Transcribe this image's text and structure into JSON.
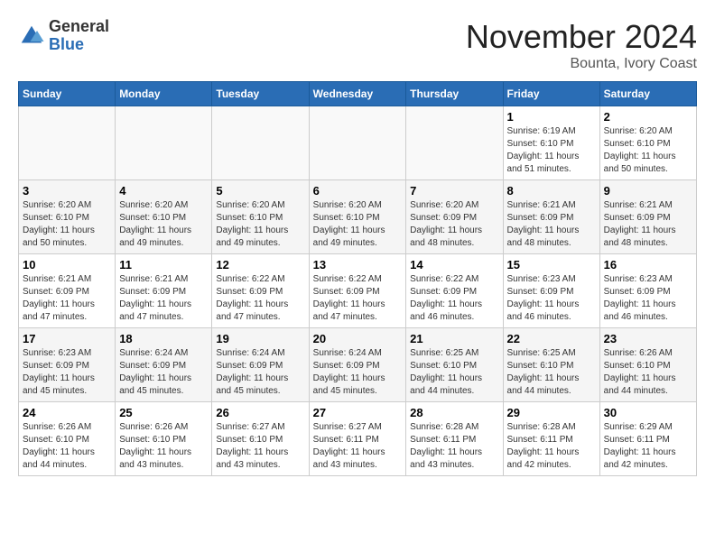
{
  "header": {
    "logo_general": "General",
    "logo_blue": "Blue",
    "month_title": "November 2024",
    "location": "Bounta, Ivory Coast"
  },
  "days_of_week": [
    "Sunday",
    "Monday",
    "Tuesday",
    "Wednesday",
    "Thursday",
    "Friday",
    "Saturday"
  ],
  "weeks": [
    {
      "days": [
        {
          "num": "",
          "empty": true
        },
        {
          "num": "",
          "empty": true
        },
        {
          "num": "",
          "empty": true
        },
        {
          "num": "",
          "empty": true
        },
        {
          "num": "",
          "empty": true
        },
        {
          "num": "1",
          "sunrise": "6:19 AM",
          "sunset": "6:10 PM",
          "daylight": "11 hours and 51 minutes."
        },
        {
          "num": "2",
          "sunrise": "6:20 AM",
          "sunset": "6:10 PM",
          "daylight": "11 hours and 50 minutes."
        }
      ]
    },
    {
      "days": [
        {
          "num": "3",
          "sunrise": "6:20 AM",
          "sunset": "6:10 PM",
          "daylight": "11 hours and 50 minutes."
        },
        {
          "num": "4",
          "sunrise": "6:20 AM",
          "sunset": "6:10 PM",
          "daylight": "11 hours and 49 minutes."
        },
        {
          "num": "5",
          "sunrise": "6:20 AM",
          "sunset": "6:10 PM",
          "daylight": "11 hours and 49 minutes."
        },
        {
          "num": "6",
          "sunrise": "6:20 AM",
          "sunset": "6:10 PM",
          "daylight": "11 hours and 49 minutes."
        },
        {
          "num": "7",
          "sunrise": "6:20 AM",
          "sunset": "6:09 PM",
          "daylight": "11 hours and 48 minutes."
        },
        {
          "num": "8",
          "sunrise": "6:21 AM",
          "sunset": "6:09 PM",
          "daylight": "11 hours and 48 minutes."
        },
        {
          "num": "9",
          "sunrise": "6:21 AM",
          "sunset": "6:09 PM",
          "daylight": "11 hours and 48 minutes."
        }
      ]
    },
    {
      "days": [
        {
          "num": "10",
          "sunrise": "6:21 AM",
          "sunset": "6:09 PM",
          "daylight": "11 hours and 47 minutes."
        },
        {
          "num": "11",
          "sunrise": "6:21 AM",
          "sunset": "6:09 PM",
          "daylight": "11 hours and 47 minutes."
        },
        {
          "num": "12",
          "sunrise": "6:22 AM",
          "sunset": "6:09 PM",
          "daylight": "11 hours and 47 minutes."
        },
        {
          "num": "13",
          "sunrise": "6:22 AM",
          "sunset": "6:09 PM",
          "daylight": "11 hours and 47 minutes."
        },
        {
          "num": "14",
          "sunrise": "6:22 AM",
          "sunset": "6:09 PM",
          "daylight": "11 hours and 46 minutes."
        },
        {
          "num": "15",
          "sunrise": "6:23 AM",
          "sunset": "6:09 PM",
          "daylight": "11 hours and 46 minutes."
        },
        {
          "num": "16",
          "sunrise": "6:23 AM",
          "sunset": "6:09 PM",
          "daylight": "11 hours and 46 minutes."
        }
      ]
    },
    {
      "days": [
        {
          "num": "17",
          "sunrise": "6:23 AM",
          "sunset": "6:09 PM",
          "daylight": "11 hours and 45 minutes."
        },
        {
          "num": "18",
          "sunrise": "6:24 AM",
          "sunset": "6:09 PM",
          "daylight": "11 hours and 45 minutes."
        },
        {
          "num": "19",
          "sunrise": "6:24 AM",
          "sunset": "6:09 PM",
          "daylight": "11 hours and 45 minutes."
        },
        {
          "num": "20",
          "sunrise": "6:24 AM",
          "sunset": "6:09 PM",
          "daylight": "11 hours and 45 minutes."
        },
        {
          "num": "21",
          "sunrise": "6:25 AM",
          "sunset": "6:10 PM",
          "daylight": "11 hours and 44 minutes."
        },
        {
          "num": "22",
          "sunrise": "6:25 AM",
          "sunset": "6:10 PM",
          "daylight": "11 hours and 44 minutes."
        },
        {
          "num": "23",
          "sunrise": "6:26 AM",
          "sunset": "6:10 PM",
          "daylight": "11 hours and 44 minutes."
        }
      ]
    },
    {
      "days": [
        {
          "num": "24",
          "sunrise": "6:26 AM",
          "sunset": "6:10 PM",
          "daylight": "11 hours and 44 minutes."
        },
        {
          "num": "25",
          "sunrise": "6:26 AM",
          "sunset": "6:10 PM",
          "daylight": "11 hours and 43 minutes."
        },
        {
          "num": "26",
          "sunrise": "6:27 AM",
          "sunset": "6:10 PM",
          "daylight": "11 hours and 43 minutes."
        },
        {
          "num": "27",
          "sunrise": "6:27 AM",
          "sunset": "6:11 PM",
          "daylight": "11 hours and 43 minutes."
        },
        {
          "num": "28",
          "sunrise": "6:28 AM",
          "sunset": "6:11 PM",
          "daylight": "11 hours and 43 minutes."
        },
        {
          "num": "29",
          "sunrise": "6:28 AM",
          "sunset": "6:11 PM",
          "daylight": "11 hours and 42 minutes."
        },
        {
          "num": "30",
          "sunrise": "6:29 AM",
          "sunset": "6:11 PM",
          "daylight": "11 hours and 42 minutes."
        }
      ]
    }
  ],
  "labels": {
    "sunrise_prefix": "Sunrise: ",
    "sunset_prefix": "Sunset: ",
    "daylight_prefix": "Daylight: "
  }
}
